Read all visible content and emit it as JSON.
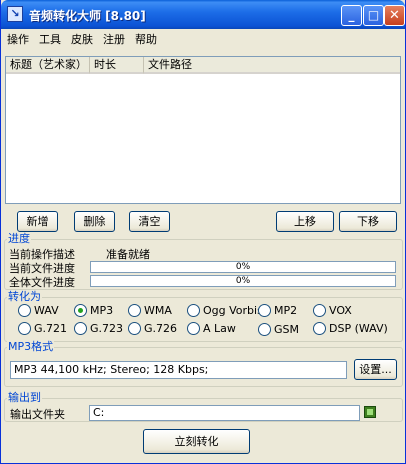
{
  "window": {
    "title": "音频转化大师 [8.80]"
  },
  "menu": [
    "操作",
    "工具",
    "皮肤",
    "注册",
    "帮助"
  ],
  "list": {
    "columns": [
      "标题（艺术家）",
      "时长",
      "文件路径"
    ]
  },
  "buttons": {
    "add": "新增",
    "delete": "删除",
    "clear": "清空",
    "move_up": "上移",
    "move_down": "下移",
    "settings": "设置...",
    "convert": "立刻转化"
  },
  "progress": {
    "legend": "进度",
    "op_label": "当前操作描述",
    "op_value": "准备就绪",
    "file_label": "当前文件进度",
    "file_pct": "0%",
    "file_value": 0,
    "all_label": "全体文件进度",
    "all_pct": "0%",
    "all_value": 0
  },
  "convert_to": {
    "legend": "转化为",
    "options": [
      "WAV",
      "MP3",
      "WMA",
      "Ogg Vorbis",
      "MP2",
      "VOX",
      "G.721",
      "G.723",
      "G.726",
      "A Law",
      "GSM",
      "DSP (WAV)"
    ],
    "selected": "MP3"
  },
  "format": {
    "legend": "MP3格式",
    "value": "MP3 44,100 kHz; Stereo;  128 Kbps;"
  },
  "output": {
    "legend": "输出到",
    "label": "输出文件夹",
    "value": "C:"
  },
  "icons": {
    "app": "app-icon",
    "folder": "folder-browse-icon"
  },
  "colors": {
    "titlebar": "#0b52d4",
    "legend": "#0046d5",
    "window_bg": "#ece9d8"
  }
}
